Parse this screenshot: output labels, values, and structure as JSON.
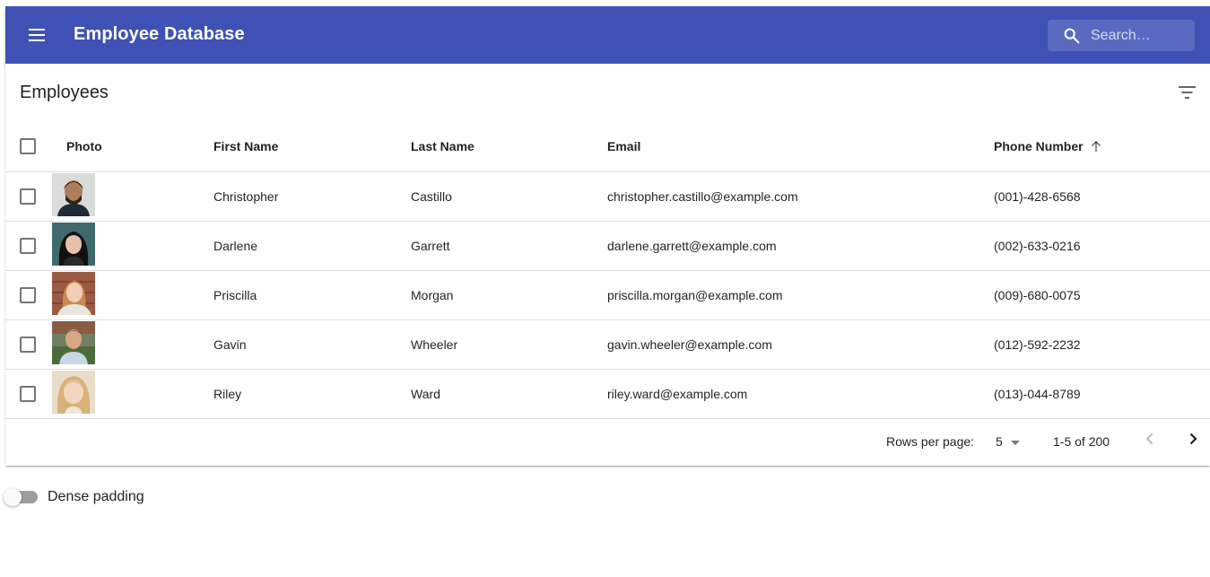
{
  "appbar": {
    "title": "Employee Database",
    "search_placeholder": "Search…"
  },
  "table": {
    "title": "Employees",
    "columns": {
      "photo": "Photo",
      "first_name": "First Name",
      "last_name": "Last Name",
      "email": "Email",
      "phone": "Phone Number"
    },
    "sort": {
      "column": "Phone Number",
      "direction": "ascending"
    },
    "rows": [
      {
        "first": "Christopher",
        "last": "Castillo",
        "email": "christopher.castillo@example.com",
        "phone": "(001)-428-6568"
      },
      {
        "first": "Darlene",
        "last": "Garrett",
        "email": "darlene.garrett@example.com",
        "phone": "(002)-633-0216"
      },
      {
        "first": "Priscilla",
        "last": "Morgan",
        "email": "priscilla.morgan@example.com",
        "phone": "(009)-680-0075"
      },
      {
        "first": "Gavin",
        "last": "Wheeler",
        "email": "gavin.wheeler@example.com",
        "phone": "(012)-592-2232"
      },
      {
        "first": "Riley",
        "last": "Ward",
        "email": "riley.ward@example.com",
        "phone": "(013)-044-8789"
      }
    ]
  },
  "pagination": {
    "rows_per_page_label": "Rows per page:",
    "rows_per_page": "5",
    "range": "1-5 of 200"
  },
  "dense": {
    "label": "Dense padding",
    "checked": false
  },
  "colors": {
    "primary": "#3f51b5"
  }
}
